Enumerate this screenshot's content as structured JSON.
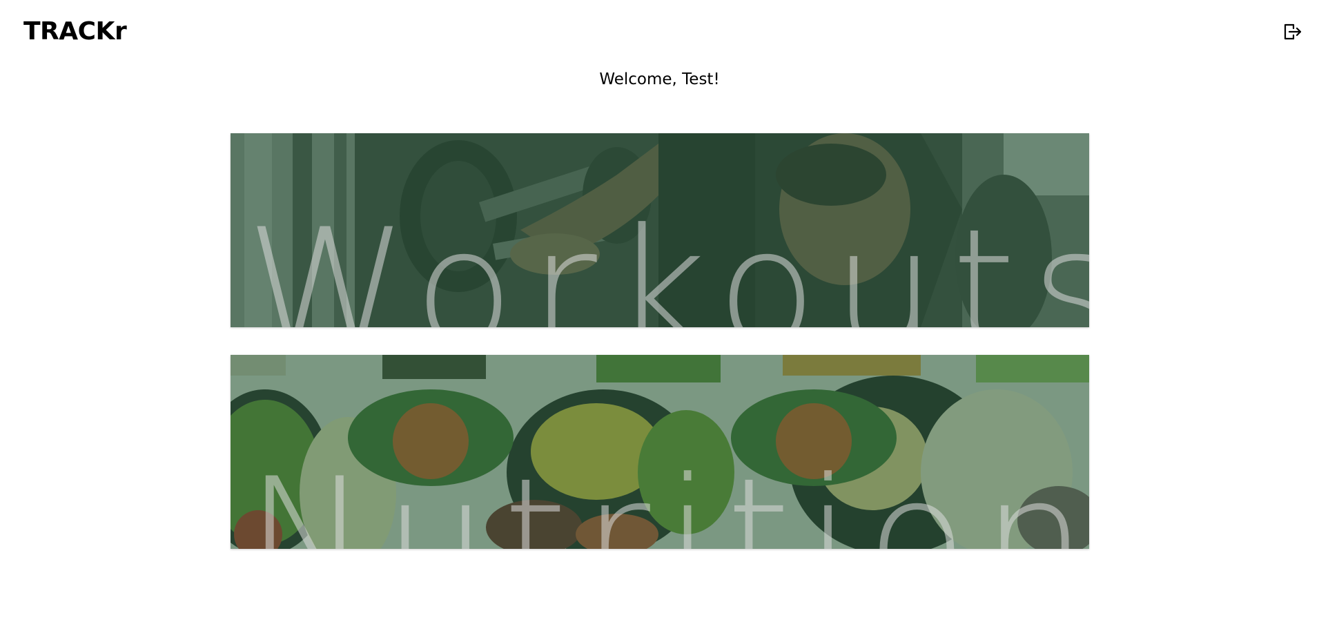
{
  "header": {
    "logo": "TRACKr",
    "logout_icon": "logout-icon"
  },
  "welcome_text": "Welcome, Test!",
  "cards": {
    "workouts": {
      "label": "Workouts",
      "background": "gym-dumbbell-photo"
    },
    "nutrition": {
      "label": "Nutrition",
      "background": "vegetable-platter-photo"
    }
  },
  "colors": {
    "overlay_green": "#2e6240",
    "label_text": "#dcdcdc"
  }
}
